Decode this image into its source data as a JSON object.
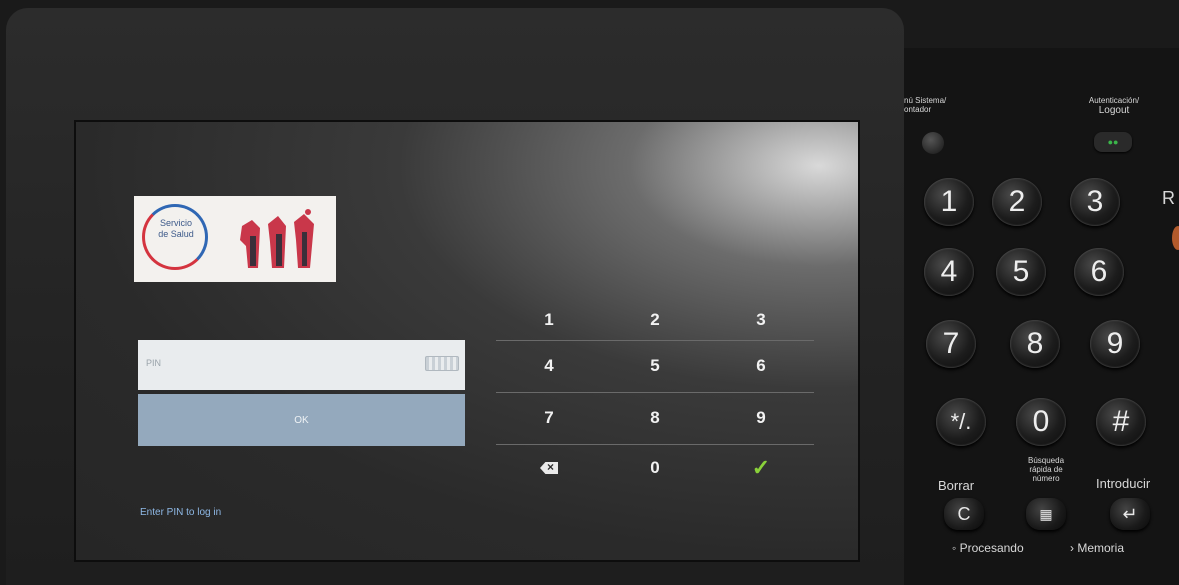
{
  "logo": {
    "org_line1": "Servicio",
    "org_line2": "de Salud"
  },
  "login": {
    "pin_placeholder": "PIN",
    "ok_label": "OK",
    "status_text": "Enter PIN to log in"
  },
  "keypad": {
    "keys": [
      "1",
      "2",
      "3",
      "4",
      "5",
      "6",
      "7",
      "8",
      "9",
      "",
      "0",
      ""
    ],
    "special": {
      "backspace": "backspace-icon",
      "confirm": "checkmark-icon"
    }
  },
  "hardware_panel": {
    "system_menu_label_line1": "nú Sistema/",
    "system_menu_label_line2": "ontador",
    "auth_label_line1": "Autenticación/",
    "auth_label_line2": "Logout",
    "keys": [
      "1",
      "2",
      "3",
      "4",
      "5",
      "6",
      "7",
      "8",
      "9",
      "*/.",
      "0",
      "#"
    ],
    "clear_label": "Borrar",
    "clear_key": "C",
    "quick_search_label_line1": "Búsqueda",
    "quick_search_label_line2": "rápida de",
    "quick_search_label_line3": "número",
    "enter_label": "Introducir",
    "processing_label": "Procesando",
    "memory_label": "Memoria",
    "edge_letter": "R"
  },
  "colors": {
    "ok_button": "#94a9bd",
    "status_text": "#8fb9e6",
    "confirm": "#8ad13a"
  }
}
